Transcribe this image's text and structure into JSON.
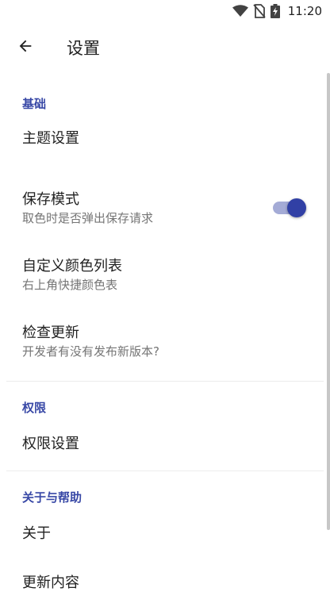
{
  "status_bar": {
    "time": "11:20",
    "icons": [
      "wifi-icon",
      "no-sim-icon",
      "battery-charging-icon"
    ]
  },
  "app_bar": {
    "title": "设置",
    "back_icon": "arrow-left-icon"
  },
  "sections": {
    "basic": {
      "header": "基础",
      "theme": {
        "title": "主题设置"
      },
      "save_mode": {
        "title": "保存模式",
        "summary": "取色时是否弹出保存请求",
        "enabled": true
      },
      "custom_colors": {
        "title": "自定义颜色列表",
        "summary": "右上角快捷颜色表"
      },
      "check_update": {
        "title": "检查更新",
        "summary": "开发者有没有发布新版本?"
      }
    },
    "permissions": {
      "header": "权限",
      "settings": {
        "title": "权限设置"
      }
    },
    "about_help": {
      "header": "关于与帮助",
      "about": {
        "title": "关于"
      },
      "changelog": {
        "title": "更新内容"
      }
    }
  },
  "colors": {
    "accent": "#3848a6",
    "switch_thumb": "#3140a5",
    "switch_track": "#a4abd6",
    "text_primary": "#212121",
    "text_secondary": "#757575"
  }
}
